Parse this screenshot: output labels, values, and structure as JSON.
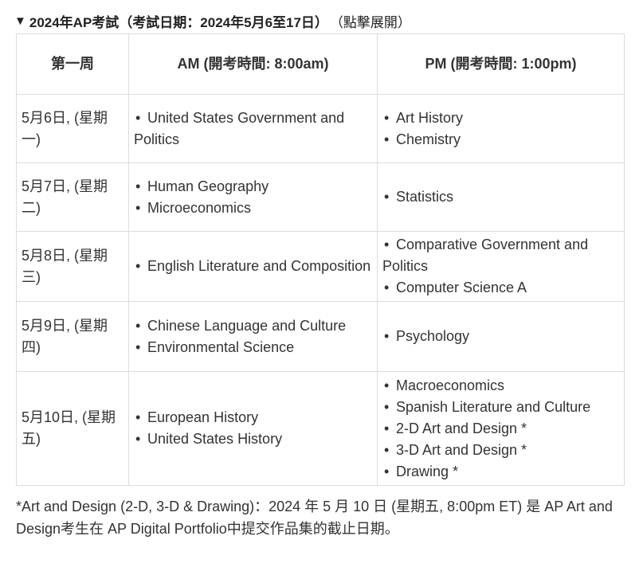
{
  "header": {
    "arrow": "▼",
    "title": "2024年AP考試（考試日期：2024年5月6至17日）",
    "expand": "（點擊展開）"
  },
  "table": {
    "headers": [
      "第一周",
      "AM (開考時間: 8:00am)",
      "PM (開考時間: 1:00pm)"
    ],
    "rows": [
      {
        "day": "5月6日, (星期一)",
        "am": [
          "United States Government and Politics"
        ],
        "pm": [
          "Art History",
          "Chemistry"
        ]
      },
      {
        "day": "5月7日, (星期二)",
        "am": [
          "Human Geography",
          "Microeconomics"
        ],
        "pm": [
          "Statistics"
        ]
      },
      {
        "day": "5月8日, (星期三)",
        "am": [
          "English Literature and Composition"
        ],
        "pm": [
          "Comparative Government and Politics",
          "Computer Science A"
        ]
      },
      {
        "day": "5月9日, (星期四)",
        "am": [
          "Chinese Language and Culture",
          "Environmental Science"
        ],
        "pm": [
          "Psychology"
        ]
      },
      {
        "day": "5月10日, (星期五)",
        "am": [
          "European History",
          "United States History"
        ],
        "pm": [
          "Macroeconomics",
          "Spanish Literature and Culture",
          "2-D Art and Design *",
          "3-D Art and Design *",
          "Drawing *"
        ]
      }
    ]
  },
  "footnote": "*Art and Design (2-D, 3-D & Drawing)：2024 年 5 月 10 日 (星期五, 8:00pm ET) 是 AP Art and Design考生在 AP Digital Portfolio中提交作品集的截止日期。"
}
